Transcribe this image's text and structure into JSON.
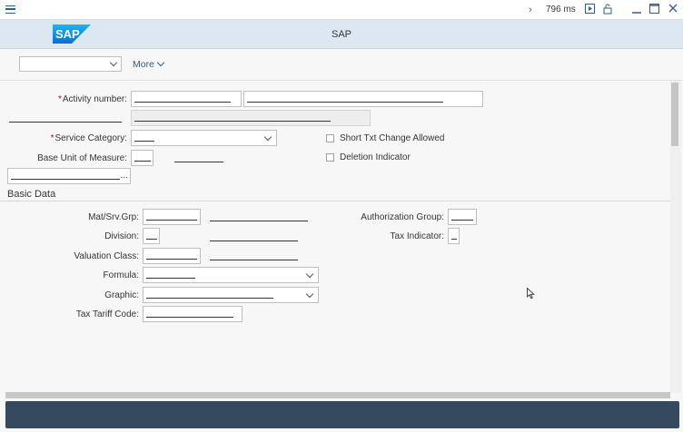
{
  "titlebar": {
    "perf_text": "796 ms",
    "icons": [
      "menu-icon",
      "chevron-right-icon",
      "play-icon",
      "lock-icon",
      "minimize-icon",
      "maximize-icon",
      "close-icon"
    ]
  },
  "shell": {
    "logo_text": "SAP",
    "title": "SAP",
    "brand_color": "#0a6ed1"
  },
  "toolbar": {
    "select_value": "",
    "more_label": "More"
  },
  "form": {
    "activity_number_label": "Activity number:",
    "service_category_label": "Service Category:",
    "base_uom_label": "Base Unit of Measure:",
    "short_txt_change_label": "Short Txt Change Allowed",
    "deletion_indicator_label": "Deletion Indicator",
    "more_button_label": "..."
  },
  "basic_data": {
    "section_title": "Basic Data",
    "mat_srv_grp_label": "Mat/Srv.Grp:",
    "division_label": "Division:",
    "valuation_class_label": "Valuation Class:",
    "formula_label": "Formula:",
    "graphic_label": "Graphic:",
    "tax_tariff_code_label": "Tax Tariff Code:",
    "authorization_group_label": "Authorization Group:",
    "tax_indicator_label": "Tax Indicator:"
  },
  "colors": {
    "shell_bg": "#dde7f1",
    "footer_bg": "#354a5f",
    "required": "#bb0000",
    "link": "#2a5e8c"
  }
}
